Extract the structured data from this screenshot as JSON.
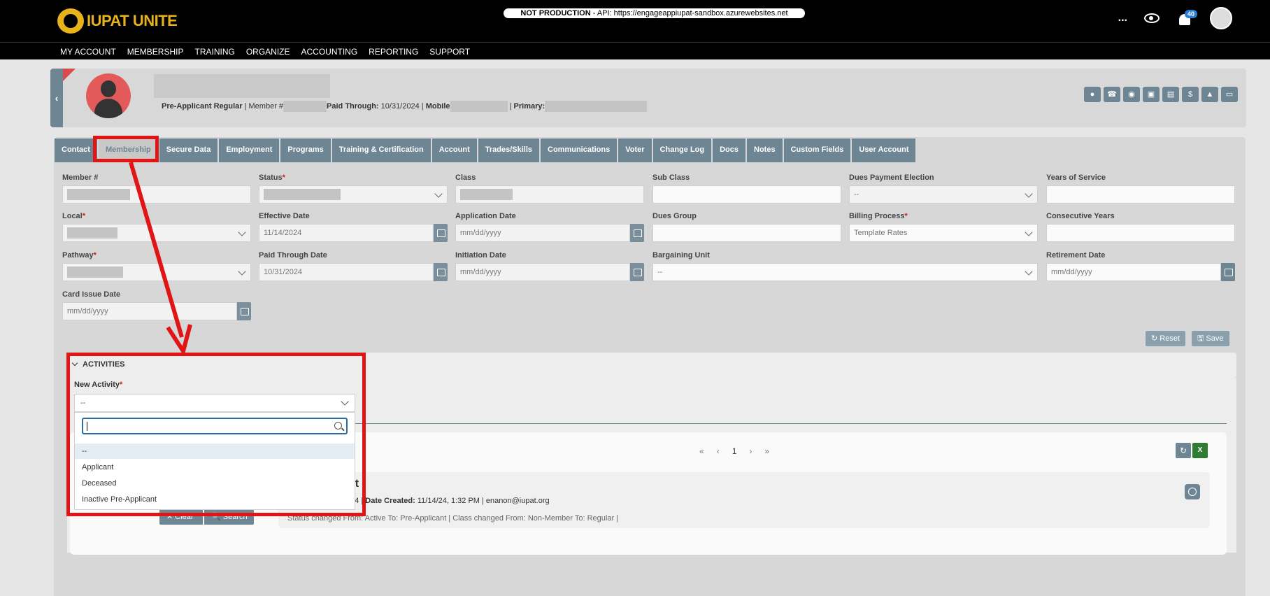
{
  "app": {
    "logo_text": "IUPAT UNITE",
    "env_label": "NOT PRODUCTION",
    "env_text": " - API: https://engageappiupat-sandbox.azurewebsites.net",
    "more_label": "...",
    "notification_count": "40"
  },
  "nav": {
    "items": [
      "MY ACCOUNT",
      "MEMBERSHIP",
      "TRAINING",
      "ORGANIZE",
      "ACCOUNTING",
      "REPORTING",
      "SUPPORT"
    ]
  },
  "profile": {
    "status_text": "Pre-Applicant Regular",
    "member_label": "Member #",
    "paid_through_label": "Paid Through:",
    "paid_through_value": "10/31/2024",
    "mobile_label": "Mobile",
    "primary_label": "Primary:",
    "collapse_glyph": "‹",
    "action_icons": [
      "user-icon",
      "phone-icon",
      "chat-icon",
      "inbox-icon",
      "document-icon",
      "dollar-icon",
      "alert-icon",
      "id-card-icon"
    ]
  },
  "tabs": [
    "Contact",
    "Membership",
    "Secure Data",
    "Employment",
    "Programs",
    "Training & Certification",
    "Account",
    "Trades/Skills",
    "Communications",
    "Voter",
    "Change Log",
    "Docs",
    "Notes",
    "Custom Fields",
    "User Account"
  ],
  "active_tab": "Membership",
  "form": {
    "member_num_label": "Member #",
    "status_label": "Status",
    "class_label": "Class",
    "sub_class_label": "Sub Class",
    "dues_payment_election_label": "Dues Payment Election",
    "dues_payment_election_value": "--",
    "years_of_service_label": "Years of Service",
    "local_label": "Local",
    "effective_date_label": "Effective Date",
    "effective_date_value": "11/14/2024",
    "application_date_label": "Application Date",
    "application_date_placeholder": "mm/dd/yyyy",
    "dues_group_label": "Dues Group",
    "billing_process_label": "Billing Process",
    "billing_process_value": "Template Rates",
    "consecutive_years_label": "Consecutive Years",
    "pathway_label": "Pathway",
    "paid_through_date_label": "Paid Through Date",
    "paid_through_date_value": "10/31/2024",
    "initiation_date_label": "Initiation Date",
    "initiation_date_placeholder": "mm/dd/yyyy",
    "bargaining_unit_label": "Bargaining Unit",
    "bargaining_unit_value": "--",
    "retirement_date_label": "Retirement Date",
    "retirement_date_placeholder": "mm/dd/yyyy",
    "card_issue_date_label": "Card Issue Date",
    "card_issue_date_placeholder": "mm/dd/yyyy",
    "required_mark": "*",
    "reset_label": "↻ Reset",
    "save_label": "🖫 Save"
  },
  "activities": {
    "title": "ACTIVITIES",
    "new_activity_label": "New Activity",
    "new_activity_value": "--",
    "dropdown_options": [
      "--",
      "Applicant",
      "Deceased",
      "Inactive Pre-Applicant"
    ],
    "pager": [
      "«",
      "‹",
      "1",
      "›",
      "»"
    ],
    "entry_fragment": "nt",
    "entry_date_fragment": "/24 |",
    "date_created_label": "Date Created:",
    "date_created_value": "11/14/24, 1:32 PM | enanon@iupat.org",
    "entry_detail": "Status changed From: Active To: Pre-Applicant | Class changed From: Non-Member To: Regular |",
    "clear_label": "✕ Clear",
    "search_label": "🔍 Search"
  },
  "colors": {
    "accent": "#6e8594",
    "highlight": "#e01515",
    "brand": "#e8b21a"
  }
}
